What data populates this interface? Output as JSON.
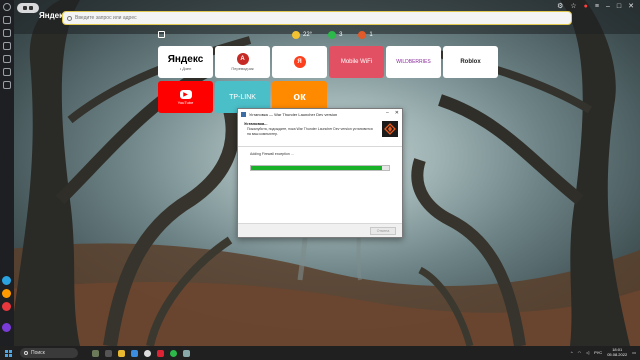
{
  "browser": {
    "brand": "Яндекс",
    "address_placeholder": "Введите запрос или адрес"
  },
  "infobar": {
    "weather": "22°",
    "counter_green": "3",
    "counter_mail": "1"
  },
  "tiles": [
    {
      "label": "Яндекс",
      "sub": "• Дзен",
      "bg": "#ffffff",
      "fg": "#000000"
    },
    {
      "label": "",
      "sub": "Переводчик",
      "bg": "#ffffff",
      "fg": "#000000"
    },
    {
      "label": "",
      "sub": "",
      "bg": "#ffffff",
      "fg": "#000000"
    },
    {
      "label": "Mobile WiFi",
      "sub": "",
      "bg": "#e25163",
      "fg": "#ffffff"
    },
    {
      "label": "WILDBERRIES",
      "sub": "",
      "bg": "#ffffff",
      "fg": "#8a2a9c"
    },
    {
      "label": "Roblox",
      "sub": "",
      "bg": "#ffffff",
      "fg": "#111111"
    },
    {
      "label": "YouTube",
      "sub": "",
      "bg": "#ff0000",
      "fg": "#ffffff"
    },
    {
      "label": "TP-LINK",
      "sub": "",
      "bg": "#4bbfc8",
      "fg": "#ffffff"
    },
    {
      "label": "",
      "sub": "",
      "bg": "#ff8a00",
      "fg": "#ffffff"
    }
  ],
  "installer": {
    "title": "Установка — War Thunder Launcher Dev version",
    "heading": "Установка...",
    "description": "Пожалуйста, подождите, пока War Thunder Launcher Dev version установится на ваш компьютер.",
    "status": "Adding Firewall exception ...",
    "progress": 0.95,
    "cancel_label": "Отмена"
  },
  "taskbar": {
    "search_label": "Поиск",
    "time": "18:01",
    "date": "05.08.2022",
    "lang": "РУС"
  },
  "colors": {
    "accent_yellow": "#e0c750",
    "progress_green": "#18b128"
  }
}
